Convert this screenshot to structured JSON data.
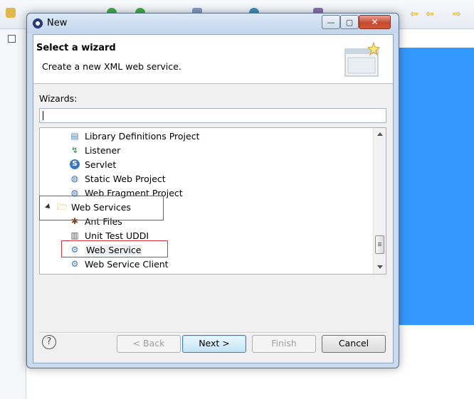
{
  "window": {
    "title": "New",
    "min_glyph": "—",
    "max_glyph": "▢",
    "close_glyph": "✕"
  },
  "banner": {
    "title": "Select a wizard",
    "description": "Create a new XML web service."
  },
  "filter": {
    "label": "Wizards:",
    "value": ""
  },
  "tree": {
    "items": [
      {
        "label": "Library Definitions Project",
        "icon": "library-definitions-project-icon",
        "level": 1
      },
      {
        "label": "Listener",
        "icon": "listener-icon",
        "level": 1
      },
      {
        "label": "Servlet",
        "icon": "servlet-icon",
        "level": 1
      },
      {
        "label": "Static Web Project",
        "icon": "static-web-project-icon",
        "level": 1
      },
      {
        "label": "Web Fragment Project",
        "icon": "web-fragment-project-icon",
        "level": 1
      },
      {
        "label": "Web Services",
        "icon": "folder-open-icon",
        "level": 0,
        "expanded": true
      },
      {
        "label": "Ant Files",
        "icon": "ant-files-icon",
        "level": 1
      },
      {
        "label": "Unit Test UDDI",
        "icon": "uddi-icon",
        "level": 1
      },
      {
        "label": "Web Service",
        "icon": "web-service-icon",
        "level": 1,
        "selected": true
      },
      {
        "label": "Web Service Client",
        "icon": "web-service-client-icon",
        "level": 1
      }
    ]
  },
  "buttons": {
    "help": "?",
    "back": "< Back",
    "next": "Next >",
    "finish": "Finish",
    "cancel": "Cancel"
  },
  "annotation_color": "#e0303a",
  "desktop_accent": "#3399ff"
}
